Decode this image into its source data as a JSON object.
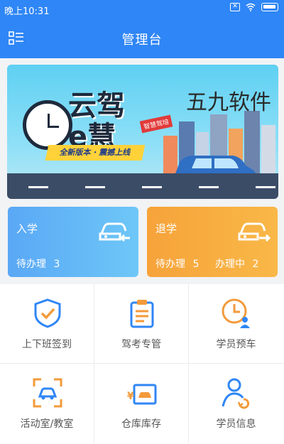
{
  "status_bar": {
    "time": "晚上10:31"
  },
  "header": {
    "title": "管理台"
  },
  "banner": {
    "logo_text": "云驾e慧",
    "slogan": "全新版本 · 震撼上线",
    "tag": "智慧驾培",
    "watermark": "五九软件"
  },
  "cards": [
    {
      "title": "入学",
      "items": [
        {
          "label": "待办理",
          "count": "3"
        }
      ]
    },
    {
      "title": "退学",
      "items": [
        {
          "label": "待办理",
          "count": "5"
        },
        {
          "label": "办理中",
          "count": "2"
        }
      ]
    }
  ],
  "menu": [
    {
      "label": "上下班签到",
      "icon": "shield-check-icon"
    },
    {
      "label": "驾考专管",
      "icon": "clipboard-icon"
    },
    {
      "label": "学员预车",
      "icon": "clock-user-icon"
    },
    {
      "label": "活动室/教室",
      "icon": "car-frame-icon"
    },
    {
      "label": "仓库库存",
      "icon": "warehouse-car-icon"
    },
    {
      "label": "学员信息",
      "icon": "user-refresh-icon"
    }
  ],
  "colors": {
    "primary": "#2f86f6",
    "enroll": "#5aa8f6",
    "withdraw": "#f6a33a",
    "accent_orange": "#f39a3a"
  }
}
